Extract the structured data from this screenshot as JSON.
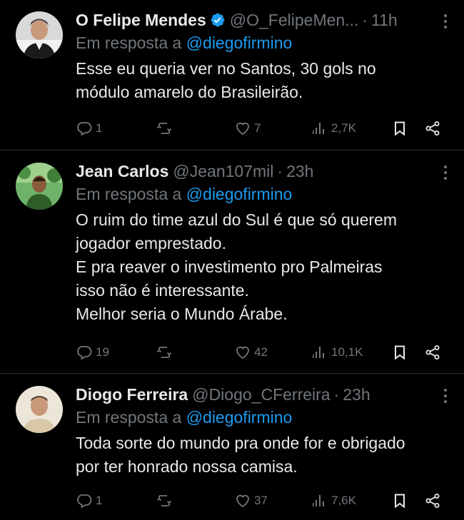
{
  "tweets": [
    {
      "name": "O Felipe Mendes",
      "verified": true,
      "handle": "@O_FelipeMen...",
      "separator": "·",
      "time": "11h",
      "reply_prefix": "Em resposta a",
      "reply_mention": "@diegofirmino",
      "lines": [
        "Esse eu queria ver no Santos, 30 gols no",
        "módulo amarelo do Brasileirão."
      ],
      "replies": "1",
      "retweets": "",
      "likes": "7",
      "views": "2,7K"
    },
    {
      "name": "Jean Carlos",
      "verified": false,
      "handle": "@Jean107mil",
      "separator": "·",
      "time": "23h",
      "reply_prefix": "Em resposta a",
      "reply_mention": "@diegofirmino",
      "lines": [
        "O ruim do time azul do Sul é que só querem",
        "jogador emprestado.",
        "E pra reaver o investimento pro Palmeiras",
        "isso não é interessante.",
        "Melhor seria o Mundo Árabe."
      ],
      "replies": "19",
      "retweets": "",
      "likes": "42",
      "views": "10,1K"
    },
    {
      "name": "Diogo Ferreira",
      "verified": false,
      "handle": "@Diogo_CFerreira",
      "separator": "·",
      "time": "23h",
      "reply_prefix": "Em resposta a",
      "reply_mention": "@diegofirmino",
      "lines": [
        "Toda sorte do mundo pra onde for e obrigado",
        "por ter honrado nossa camisa."
      ],
      "replies": "1",
      "retweets": "",
      "likes": "37",
      "views": "7,6K"
    }
  ],
  "icons": {
    "reply": "reply-icon",
    "retweet": "retweet-icon",
    "like": "heart-icon",
    "views": "views-icon",
    "bookmark": "bookmark-icon",
    "share": "share-icon",
    "more": "more-options-icon",
    "verified": "verified-badge-icon"
  },
  "colors": {
    "background": "#000000",
    "text": "#e7e9ea",
    "secondary": "#71767b",
    "link": "#1d9bf0",
    "divider": "#2f3336"
  }
}
